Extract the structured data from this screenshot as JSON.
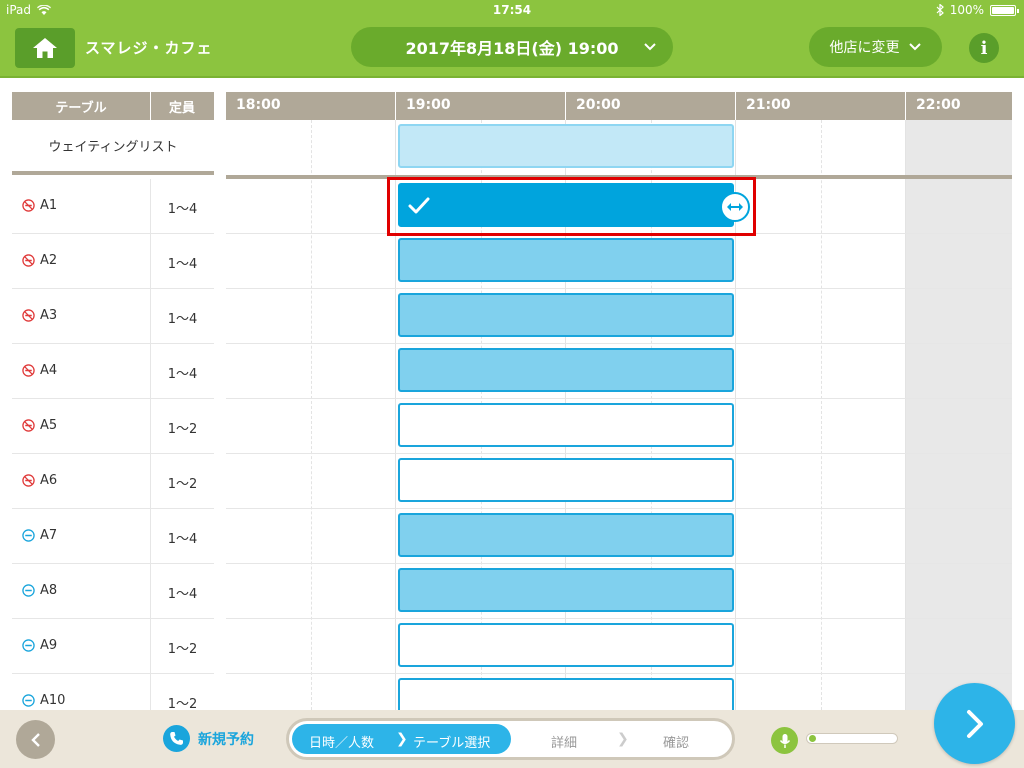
{
  "status_bar": {
    "device": "iPad",
    "time": "17:54",
    "battery": "100%"
  },
  "header": {
    "shop_name": "スマレジ・カフェ",
    "datetime": "2017年8月18日(金) 19:00",
    "change_store": "他店に変更",
    "info_label": "i"
  },
  "table_list": {
    "col_table": "テーブル",
    "col_capacity": "定員",
    "waiting_list": "ウェイティングリスト",
    "rows": [
      {
        "name": "A1",
        "capacity": "1〜4",
        "smoking": "no-smoking",
        "block": "selected"
      },
      {
        "name": "A2",
        "capacity": "1〜4",
        "smoking": "no-smoking",
        "block": "filled"
      },
      {
        "name": "A3",
        "capacity": "1〜4",
        "smoking": "no-smoking",
        "block": "filled"
      },
      {
        "name": "A4",
        "capacity": "1〜4",
        "smoking": "no-smoking",
        "block": "filled"
      },
      {
        "name": "A5",
        "capacity": "1〜2",
        "smoking": "no-smoking",
        "block": "empty"
      },
      {
        "name": "A6",
        "capacity": "1〜2",
        "smoking": "no-smoking",
        "block": "empty"
      },
      {
        "name": "A7",
        "capacity": "1〜4",
        "smoking": "smoking",
        "block": "filled"
      },
      {
        "name": "A8",
        "capacity": "1〜4",
        "smoking": "smoking",
        "block": "filled"
      },
      {
        "name": "A9",
        "capacity": "1〜2",
        "smoking": "smoking",
        "block": "empty"
      },
      {
        "name": "A10",
        "capacity": "1〜2",
        "smoking": "smoking",
        "block": "empty"
      }
    ]
  },
  "timeline": {
    "hours": [
      "18:00",
      "19:00",
      "20:00",
      "21:00",
      "22:00"
    ]
  },
  "footer": {
    "new_reservation": "新規予約",
    "steps": [
      "日時／人数",
      "テーブル選択",
      "詳細",
      "確認"
    ],
    "active_step": 1
  },
  "colors": {
    "brand_green": "#8cc43f",
    "accent_blue": "#00a4dd",
    "header_tan": "#b0a898",
    "selection_red": "#e00000"
  }
}
